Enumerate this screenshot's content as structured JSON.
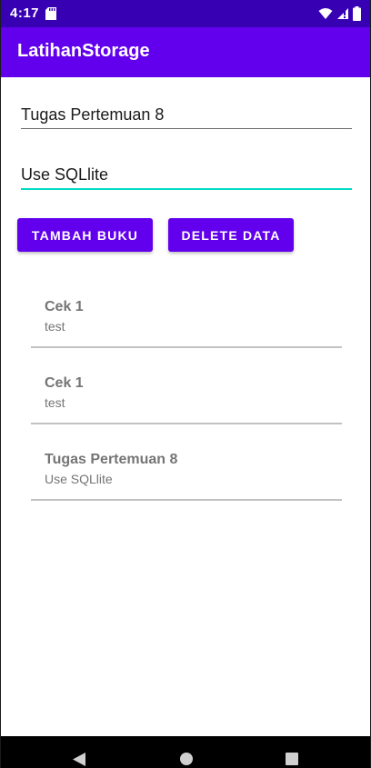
{
  "status_bar": {
    "time": "4:17",
    "icons": [
      "sd-card-icon",
      "wifi-icon",
      "cell-signal-icon",
      "battery-icon"
    ]
  },
  "app_bar": {
    "title": "LatihanStorage"
  },
  "form": {
    "title_value": "Tugas Pertemuan 8",
    "desc_value": "Use SQLlite"
  },
  "buttons": {
    "add_label": "TAMBAH BUKU",
    "delete_label": "DELETE DATA"
  },
  "list": [
    {
      "title": "Cek 1",
      "subtitle": "test"
    },
    {
      "title": "Cek 1",
      "subtitle": "test"
    },
    {
      "title": "Tugas Pertemuan 8",
      "subtitle": "Use SQLlite"
    }
  ],
  "nav_bar": {
    "icons": [
      "back-icon",
      "home-icon",
      "recents-icon"
    ]
  },
  "colors": {
    "primary": "#6200ee",
    "primary_dark": "#3700b3",
    "accent": "#03dac5"
  }
}
